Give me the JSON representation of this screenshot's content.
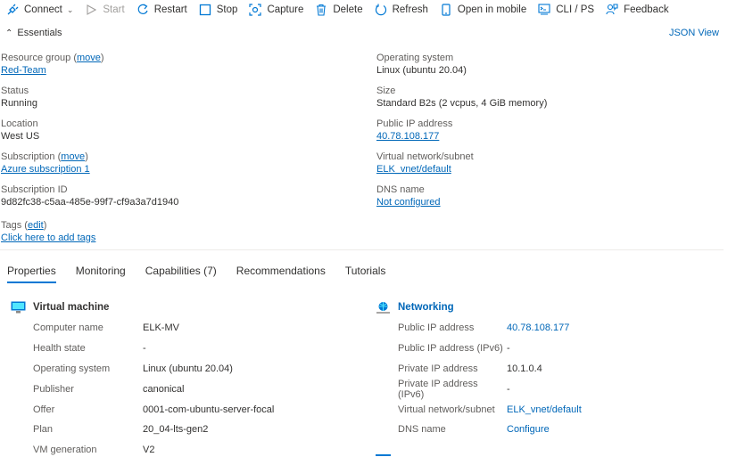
{
  "toolbar": {
    "connect": "Connect",
    "start": "Start",
    "restart": "Restart",
    "stop": "Stop",
    "capture": "Capture",
    "delete": "Delete",
    "refresh": "Refresh",
    "open_mobile": "Open in mobile",
    "cli": "CLI / PS",
    "feedback": "Feedback"
  },
  "essentials": {
    "title": "Essentials",
    "json_view": "JSON View",
    "resource_group_label": "Resource group",
    "move1": "move",
    "resource_group": "Red-Team",
    "status_label": "Status",
    "status": "Running",
    "location_label": "Location",
    "location": "West US",
    "subscription_label": "Subscription",
    "move2": "move",
    "subscription": "Azure subscription 1",
    "subscription_id_label": "Subscription ID",
    "subscription_id": "9d82fc38-c5aa-485e-99f7-cf9a3a7d1940",
    "os_label": "Operating system",
    "os": "Linux (ubuntu 20.04)",
    "size_label": "Size",
    "size": "Standard B2s (2 vcpus, 4 GiB memory)",
    "public_ip_label": "Public IP address",
    "public_ip": "40.78.108.177",
    "vnet_label": "Virtual network/subnet",
    "vnet": "ELK_vnet/default",
    "dns_label": "DNS name",
    "dns": "Not configured",
    "tags_label": "Tags",
    "edit": "edit",
    "add_tags": "Click here to add tags"
  },
  "tabs": [
    "Properties",
    "Monitoring",
    "Capabilities (7)",
    "Recommendations",
    "Tutorials"
  ],
  "vm": {
    "title": "Virtual machine",
    "rows": [
      {
        "k": "Computer name",
        "v": "ELK-MV"
      },
      {
        "k": "Health state",
        "v": "-"
      },
      {
        "k": "Operating system",
        "v": "Linux (ubuntu 20.04)"
      },
      {
        "k": "Publisher",
        "v": "canonical"
      },
      {
        "k": "Offer",
        "v": "0001-com-ubuntu-server-focal"
      },
      {
        "k": "Plan",
        "v": "20_04-lts-gen2"
      },
      {
        "k": "VM generation",
        "v": "V2"
      }
    ]
  },
  "networking": {
    "title": "Networking",
    "rows": [
      {
        "k": "Public IP address",
        "v": "40.78.108.177"
      },
      {
        "k": "Public IP address (IPv6)",
        "v": "-"
      },
      {
        "k": "Private IP address",
        "v": "10.1.0.4"
      },
      {
        "k": "Private IP address (IPv6)",
        "v": "-"
      },
      {
        "k": "Virtual network/subnet",
        "v": "ELK_vnet/default"
      },
      {
        "k": "DNS name",
        "v": "Configure"
      }
    ]
  },
  "icons": {
    "connect": "plug-icon",
    "start": "play-icon",
    "restart": "restart-icon",
    "stop": "stop-icon",
    "capture": "capture-icon",
    "delete": "trash-icon",
    "refresh": "refresh-icon",
    "open_mobile": "mobile-icon",
    "cli": "terminal-icon",
    "feedback": "feedback-icon"
  },
  "colors": {
    "accent": "#0078d4",
    "link": "#0067b8"
  }
}
